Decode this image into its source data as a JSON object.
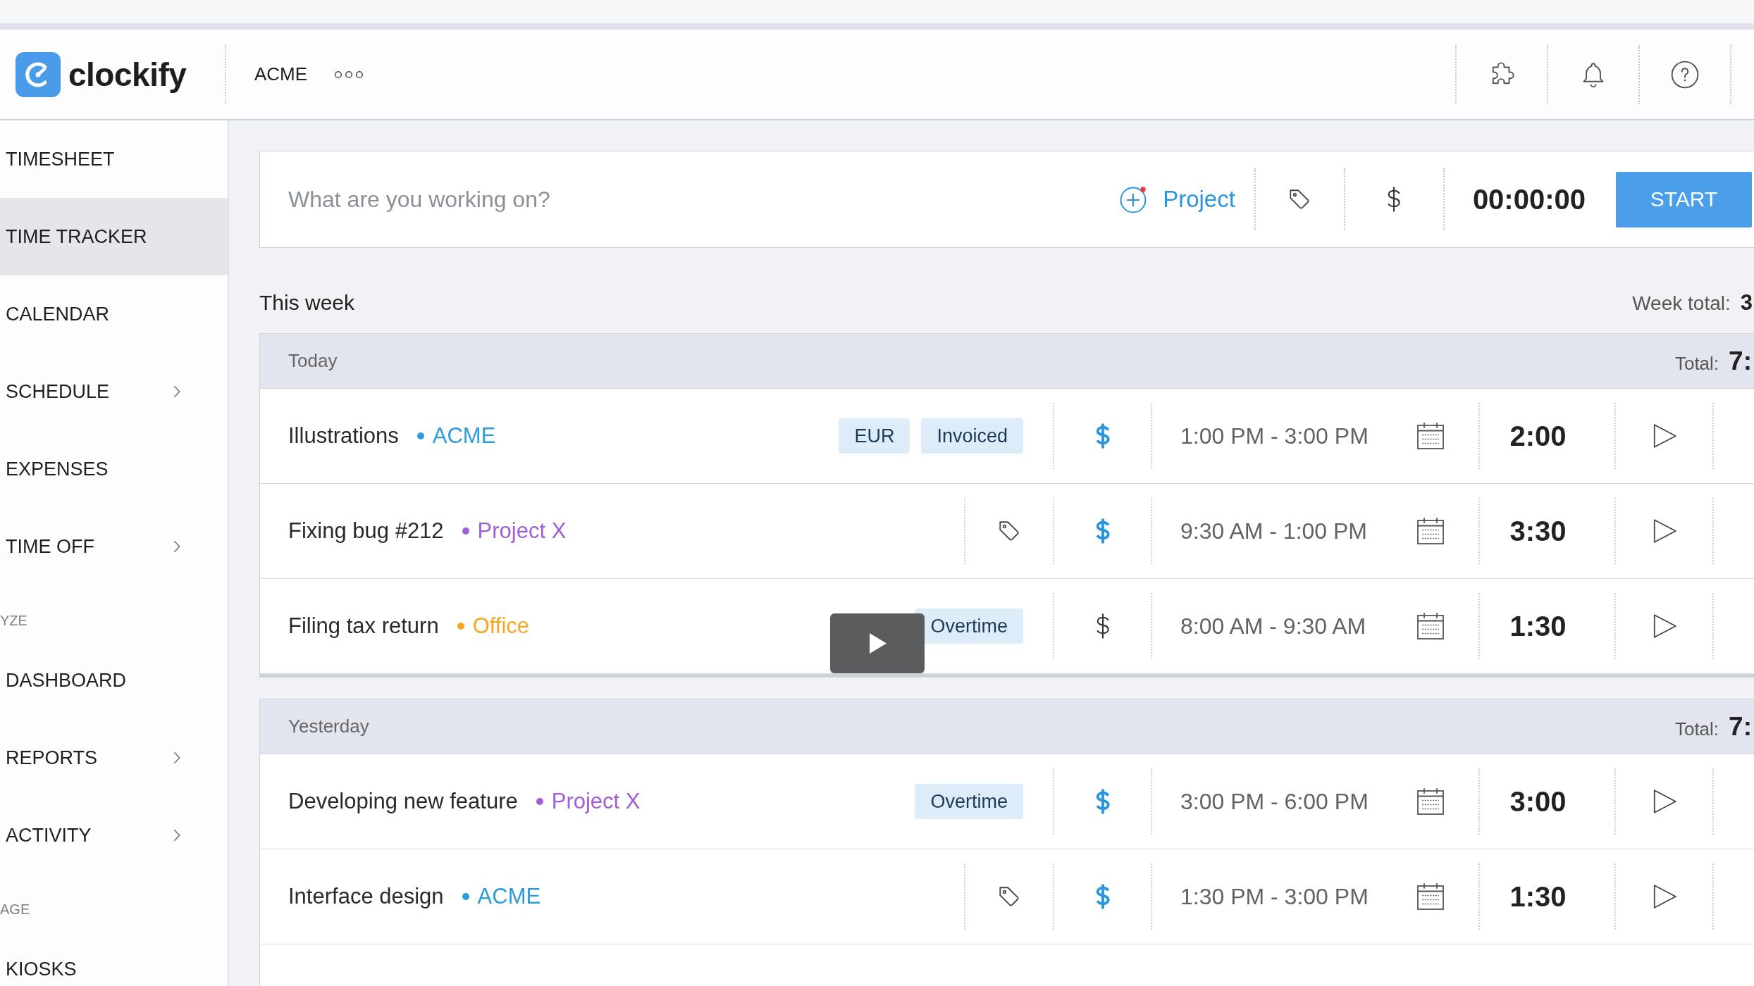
{
  "header": {
    "logo": "clockify",
    "workspace": "ACME"
  },
  "sidebar": {
    "items": [
      {
        "kind": "link",
        "label": "TIMESHEET",
        "selected": false,
        "has_submenu": false
      },
      {
        "kind": "link",
        "label": "TIME TRACKER",
        "selected": true,
        "has_submenu": false
      },
      {
        "kind": "link",
        "label": "CALENDAR",
        "selected": false,
        "has_submenu": false
      },
      {
        "kind": "link",
        "label": "SCHEDULE",
        "selected": false,
        "has_submenu": true
      },
      {
        "kind": "link",
        "label": "EXPENSES",
        "selected": false,
        "has_submenu": false
      },
      {
        "kind": "link",
        "label": "TIME OFF",
        "selected": false,
        "has_submenu": true
      },
      {
        "kind": "section",
        "label": "YZE"
      },
      {
        "kind": "link",
        "label": "DASHBOARD",
        "selected": false,
        "has_submenu": false
      },
      {
        "kind": "link",
        "label": "REPORTS",
        "selected": false,
        "has_submenu": true
      },
      {
        "kind": "link",
        "label": "ACTIVITY",
        "selected": false,
        "has_submenu": true
      },
      {
        "kind": "section",
        "label": "AGE"
      },
      {
        "kind": "link",
        "label": "KIOSKS",
        "selected": false,
        "has_submenu": false
      }
    ]
  },
  "timer": {
    "placeholder": "What are you working on?",
    "project": "Project",
    "time": "00:00:00",
    "start": "START"
  },
  "week": {
    "title": "This week",
    "total_label": "Week total:",
    "total": "3"
  },
  "days": [
    {
      "label": "Today",
      "total_label": "Total:",
      "total": "7:",
      "entries": [
        {
          "description": "Illustrations",
          "project": "ACME",
          "color": "#2d9cdb",
          "tags": [
            "EUR",
            "Invoiced"
          ],
          "billable": true,
          "time_range": "1:00 PM - 3:00 PM",
          "duration": "2:00"
        },
        {
          "description": "Fixing bug #212",
          "project": "Project X",
          "color": "#a35dd6",
          "billable": true,
          "time_range": "9:30 AM - 1:00 PM",
          "duration": "3:30"
        },
        {
          "description": "Filing tax return",
          "project": "Office",
          "color": "#f5a623",
          "tags": [
            "Overtime"
          ],
          "billable": false,
          "time_range": "8:00 AM - 9:30 AM",
          "duration": "1:30"
        }
      ]
    },
    {
      "label": "Yesterday",
      "total_label": "Total:",
      "total": "7:",
      "entries": [
        {
          "description": "Developing new feature",
          "project": "Project X",
          "color": "#a35dd6",
          "tags": [
            "Overtime"
          ],
          "billable": true,
          "time_range": "3:00 PM - 6:00 PM",
          "duration": "3:00"
        },
        {
          "description": "Interface design",
          "project": "ACME",
          "color": "#2d9cdb",
          "billable": true,
          "time_range": "1:30 PM - 3:00 PM",
          "duration": "1:30"
        }
      ]
    }
  ]
}
